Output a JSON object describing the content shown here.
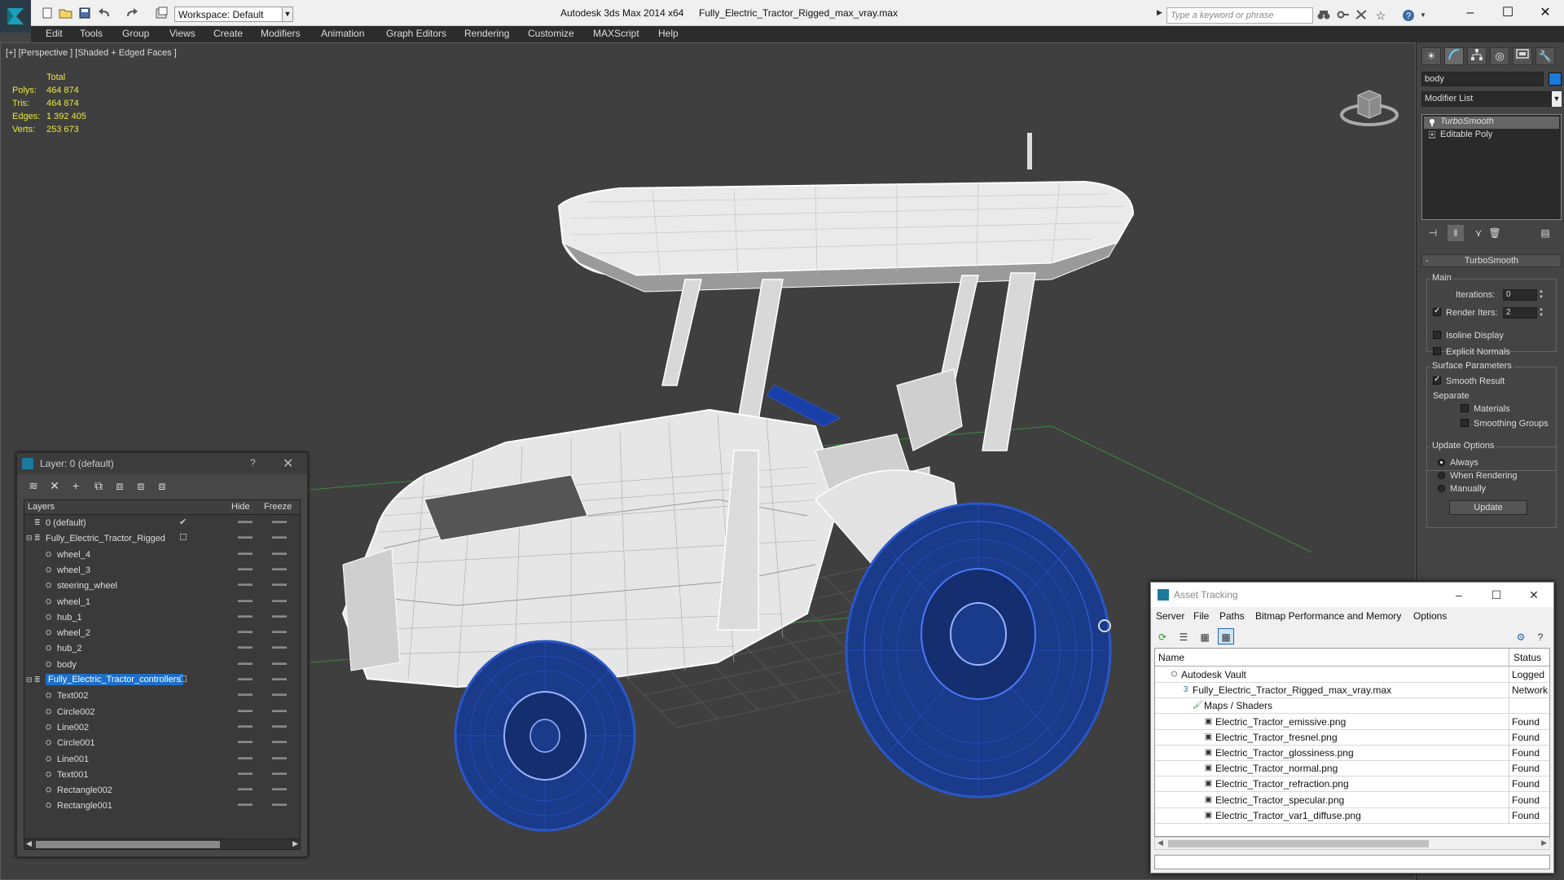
{
  "titlebar": {
    "app_title": "Autodesk 3ds Max  2014 x64",
    "file_title": "Fully_Electric_Tractor_Rigged_max_vray.max",
    "workspace": "Workspace: Default",
    "search_placeholder": "Type a keyword or phrase"
  },
  "menu": [
    "Edit",
    "Tools",
    "Group",
    "Views",
    "Create",
    "Modifiers",
    "Animation",
    "Graph Editors",
    "Rendering",
    "Customize",
    "MAXScript",
    "Help"
  ],
  "viewport": {
    "label": "[+] [Perspective ] [Shaded + Edged Faces ]",
    "stats": {
      "header": "Total",
      "polys_label": "Polys:",
      "polys": "464 874",
      "tris_label": "Tris:",
      "tris": "464 874",
      "edges_label": "Edges:",
      "edges": "1 392 405",
      "verts_label": "Verts:",
      "verts": "253 673"
    },
    "colors": {
      "wire": "#ffffff",
      "selected_wire": "#1a3fa8",
      "grid": "#555555",
      "stats": "#e8e840"
    }
  },
  "command_panel": {
    "object_name": "body",
    "object_color": "#1d7ad8",
    "modifier_list": "Modifier List",
    "stack": [
      "TurboSmooth",
      "Editable Poly"
    ],
    "rollout_title": "TurboSmooth",
    "main_label": "Main",
    "iterations_label": "Iterations:",
    "iterations": "0",
    "render_iters_label": "Render Iters:",
    "render_iters": "2",
    "isoline_label": "Isoline Display",
    "explicit_label": "Explicit Normals",
    "surface_label": "Surface Parameters",
    "smooth_label": "Smooth Result",
    "separate_label": "Separate",
    "materials_label": "Materials",
    "smoothing_groups_label": "Smoothing Groups",
    "update_options_label": "Update Options",
    "always_label": "Always",
    "when_rendering_label": "When Rendering",
    "manually_label": "Manually",
    "update_button": "Update"
  },
  "layer_explorer": {
    "title": "Layer: 0 (default)",
    "help": "?",
    "columns": {
      "layers": "Layers",
      "hide": "Hide",
      "freeze": "Freeze"
    },
    "rows": [
      {
        "name": "0 (default)",
        "level": 1,
        "kind": "layer"
      },
      {
        "name": "Fully_Electric_Tractor_Rigged",
        "level": 1,
        "kind": "layer"
      },
      {
        "name": "wheel_4",
        "level": 2,
        "kind": "object"
      },
      {
        "name": "wheel_3",
        "level": 2,
        "kind": "object"
      },
      {
        "name": "steering_wheel",
        "level": 2,
        "kind": "object"
      },
      {
        "name": "wheel_1",
        "level": 2,
        "kind": "object"
      },
      {
        "name": "hub_1",
        "level": 2,
        "kind": "object"
      },
      {
        "name": "wheel_2",
        "level": 2,
        "kind": "object"
      },
      {
        "name": "hub_2",
        "level": 2,
        "kind": "object"
      },
      {
        "name": "body",
        "level": 2,
        "kind": "object"
      },
      {
        "name": "Fully_Electric_Tractor_controllers",
        "level": 1,
        "kind": "layer",
        "selected": true
      },
      {
        "name": "Text002",
        "level": 2,
        "kind": "object"
      },
      {
        "name": "Circle002",
        "level": 2,
        "kind": "object"
      },
      {
        "name": "Line002",
        "level": 2,
        "kind": "object"
      },
      {
        "name": "Circle001",
        "level": 2,
        "kind": "object"
      },
      {
        "name": "Line001",
        "level": 2,
        "kind": "object"
      },
      {
        "name": "Text001",
        "level": 2,
        "kind": "object"
      },
      {
        "name": "Rectangle002",
        "level": 2,
        "kind": "object"
      },
      {
        "name": "Rectangle001",
        "level": 2,
        "kind": "object"
      }
    ]
  },
  "asset_tracking": {
    "title": "Asset Tracking",
    "menu": [
      "Server",
      "File",
      "Paths",
      "Bitmap Performance and Memory",
      "Options"
    ],
    "columns": {
      "name": "Name",
      "status": "Status"
    },
    "rows": [
      {
        "name": "Autodesk Vault",
        "status": "Logged",
        "level": 0,
        "icon": "vault"
      },
      {
        "name": "Fully_Electric_Tractor_Rigged_max_vray.max",
        "status": "Network",
        "level": 1,
        "icon": "max"
      },
      {
        "name": "Maps / Shaders",
        "status": "",
        "level": 2,
        "icon": "maps"
      },
      {
        "name": "Electric_Tractor_emissive.png",
        "status": "Found",
        "level": 3,
        "icon": "bitmap"
      },
      {
        "name": "Electric_Tractor_fresnel.png",
        "status": "Found",
        "level": 3,
        "icon": "bitmap"
      },
      {
        "name": "Electric_Tractor_glossiness.png",
        "status": "Found",
        "level": 3,
        "icon": "bitmap"
      },
      {
        "name": "Electric_Tractor_normal.png",
        "status": "Found",
        "level": 3,
        "icon": "bitmap"
      },
      {
        "name": "Electric_Tractor_refraction.png",
        "status": "Found",
        "level": 3,
        "icon": "bitmap"
      },
      {
        "name": "Electric_Tractor_specular.png",
        "status": "Found",
        "level": 3,
        "icon": "bitmap"
      },
      {
        "name": "Electric_Tractor_var1_diffuse.png",
        "status": "Found",
        "level": 3,
        "icon": "bitmap"
      }
    ]
  }
}
